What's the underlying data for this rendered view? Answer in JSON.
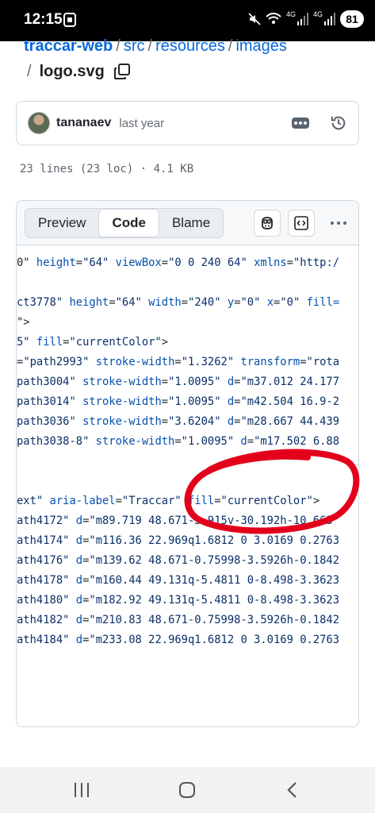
{
  "status_bar": {
    "time": "12:15",
    "network_a": "4G",
    "network_b": "4G",
    "battery": "81"
  },
  "breadcrumb": {
    "repo": "traccar-web",
    "path1": "src",
    "path2": "resources",
    "path3": "images",
    "separator": "/",
    "filename": "logo.svg"
  },
  "commit": {
    "author": "tananaev",
    "time": "last year"
  },
  "file_info": {
    "text": "23 lines (23 loc) · 4.1 KB"
  },
  "tabs": [
    {
      "label": "Preview"
    },
    {
      "label": "Code"
    },
    {
      "label": "Blame"
    }
  ],
  "code_lines": [
    {
      "seg": [
        [
          "0\"",
          "plain"
        ],
        [
          " height",
          "attr"
        ],
        [
          "=",
          "plain"
        ],
        [
          "\"64\"",
          "str"
        ],
        [
          " viewBox",
          "attr"
        ],
        [
          "=",
          "plain"
        ],
        [
          "\"0 0 240 64\"",
          "str"
        ],
        [
          " xmlns",
          "attr"
        ],
        [
          "=",
          "plain"
        ],
        [
          "\"http:/",
          "str"
        ]
      ]
    },
    {
      "seg": []
    },
    {
      "seg": [
        [
          "ct3778\"",
          "str"
        ],
        [
          " height",
          "attr"
        ],
        [
          "=",
          "plain"
        ],
        [
          "\"64\"",
          "str"
        ],
        [
          " width",
          "attr"
        ],
        [
          "=",
          "plain"
        ],
        [
          "\"240\"",
          "str"
        ],
        [
          " y",
          "attr"
        ],
        [
          "=",
          "plain"
        ],
        [
          "\"0\"",
          "str"
        ],
        [
          " x",
          "attr"
        ],
        [
          "=",
          "plain"
        ],
        [
          "\"0\"",
          "str"
        ],
        [
          " fill=",
          "attr"
        ]
      ]
    },
    {
      "seg": [
        [
          "\">",
          "plain"
        ]
      ]
    },
    {
      "seg": [
        [
          "5\"",
          "str"
        ],
        [
          " fill",
          "attr"
        ],
        [
          "=",
          "plain"
        ],
        [
          "\"currentColor\"",
          "str"
        ],
        [
          ">",
          "plain"
        ]
      ]
    },
    {
      "seg": [
        [
          "=",
          "plain"
        ],
        [
          "\"path2993\"",
          "str"
        ],
        [
          " stroke-width",
          "attr"
        ],
        [
          "=",
          "plain"
        ],
        [
          "\"1.3262\"",
          "str"
        ],
        [
          " transform",
          "attr"
        ],
        [
          "=",
          "plain"
        ],
        [
          "\"rota",
          "str"
        ]
      ]
    },
    {
      "seg": [
        [
          "path3004\"",
          "str"
        ],
        [
          " stroke-width",
          "attr"
        ],
        [
          "=",
          "plain"
        ],
        [
          "\"1.0095\"",
          "str"
        ],
        [
          " d",
          "attr"
        ],
        [
          "=",
          "plain"
        ],
        [
          "\"m37.012 24.177",
          "str"
        ]
      ]
    },
    {
      "seg": [
        [
          "path3014\"",
          "str"
        ],
        [
          " stroke-width",
          "attr"
        ],
        [
          "=",
          "plain"
        ],
        [
          "\"1.0095\"",
          "str"
        ],
        [
          " d",
          "attr"
        ],
        [
          "=",
          "plain"
        ],
        [
          "\"m42.504 16.9-2",
          "str"
        ]
      ]
    },
    {
      "seg": [
        [
          "path3036\"",
          "str"
        ],
        [
          " stroke-width",
          "attr"
        ],
        [
          "=",
          "plain"
        ],
        [
          "\"3.6204\"",
          "str"
        ],
        [
          " d",
          "attr"
        ],
        [
          "=",
          "plain"
        ],
        [
          "\"m28.667 44.439",
          "str"
        ]
      ]
    },
    {
      "seg": [
        [
          "path3038-8\"",
          "str"
        ],
        [
          " stroke-width",
          "attr"
        ],
        [
          "=",
          "plain"
        ],
        [
          "\"1.0095\"",
          "str"
        ],
        [
          " d",
          "attr"
        ],
        [
          "=",
          "plain"
        ],
        [
          "\"m17.502 6.88",
          "str"
        ]
      ]
    },
    {
      "seg": []
    },
    {
      "seg": []
    },
    {
      "seg": [
        [
          "ext\"",
          "str"
        ],
        [
          " aria-label",
          "attr"
        ],
        [
          "=",
          "plain"
        ],
        [
          "\"Traccar\"",
          "str"
        ],
        [
          " fill",
          "attr"
        ],
        [
          "=",
          "plain"
        ],
        [
          "\"currentColor\"",
          "str"
        ],
        [
          ">",
          "plain"
        ]
      ]
    },
    {
      "seg": [
        [
          "ath4172\"",
          "str"
        ],
        [
          " d",
          "attr"
        ],
        [
          "=",
          "plain"
        ],
        [
          "\"m89.719 48.671-3.915v-30.192h-10.663",
          "str"
        ]
      ]
    },
    {
      "seg": [
        [
          "ath4174\"",
          "str"
        ],
        [
          " d",
          "attr"
        ],
        [
          "=",
          "plain"
        ],
        [
          "\"m116.36 22.969q1.6812 0 3.0169 0.2763",
          "str"
        ]
      ]
    },
    {
      "seg": [
        [
          "ath4176\"",
          "str"
        ],
        [
          " d",
          "attr"
        ],
        [
          "=",
          "plain"
        ],
        [
          "\"m139.62 48.671-0.75998-3.5926h-0.1842",
          "str"
        ]
      ]
    },
    {
      "seg": [
        [
          "ath4178\"",
          "str"
        ],
        [
          " d",
          "attr"
        ],
        [
          "=",
          "plain"
        ],
        [
          "\"m160.44 49.131q-5.4811 0-8.498-3.3623",
          "str"
        ]
      ]
    },
    {
      "seg": [
        [
          "ath4180\"",
          "str"
        ],
        [
          " d",
          "attr"
        ],
        [
          "=",
          "plain"
        ],
        [
          "\"m182.92 49.131q-5.4811 0-8.498-3.3623",
          "str"
        ]
      ]
    },
    {
      "seg": [
        [
          "ath4182\"",
          "str"
        ],
        [
          " d",
          "attr"
        ],
        [
          "=",
          "plain"
        ],
        [
          "\"m210.83 48.671-0.75998-3.5926h-0.1842",
          "str"
        ]
      ]
    },
    {
      "seg": [
        [
          "ath4184\"",
          "str"
        ],
        [
          " d",
          "attr"
        ],
        [
          "=",
          "plain"
        ],
        [
          "\"m233.08 22.969q1.6812 0 3.0169 0.2763",
          "str"
        ]
      ]
    }
  ],
  "colors": {
    "link": "#0969da",
    "attr": "#0550ae",
    "string": "#0a3069",
    "annotation": "#e3001b"
  }
}
